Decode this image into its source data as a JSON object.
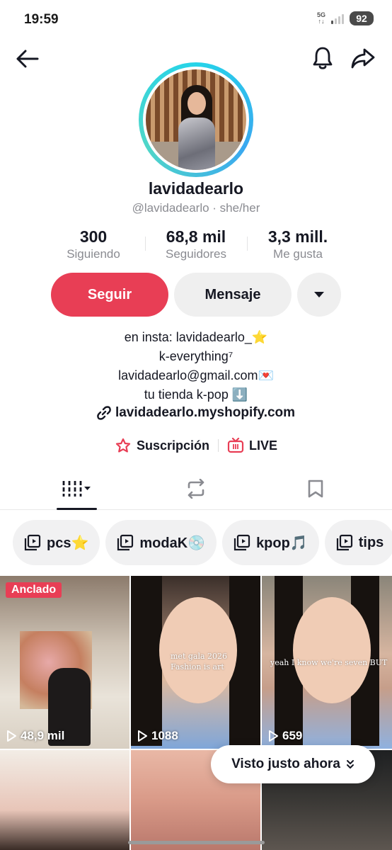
{
  "status_bar": {
    "time": "19:59",
    "network": "5G",
    "battery": "92"
  },
  "profile": {
    "username": "lavidadearlo",
    "handle_line": "@lavidadearlo · she/her"
  },
  "stats": [
    {
      "value": "300",
      "label": "Siguiendo"
    },
    {
      "value": "68,8 mil",
      "label": "Seguidores"
    },
    {
      "value": "3,3 mill.",
      "label": "Me gusta"
    }
  ],
  "actions": {
    "follow": "Seguir",
    "message": "Mensaje"
  },
  "bio": {
    "lines": [
      "en insta: lavidadearlo_⭐",
      "k-everything⁷",
      "lavidadearlo@gmail.com💌",
      "tu tienda k-pop ⬇️"
    ],
    "link": "lavidadearlo.myshopify.com"
  },
  "extras": {
    "subscription": "Suscripción",
    "live": "LIVE"
  },
  "playlists": [
    {
      "label": "pcs⭐"
    },
    {
      "label": "modaK💿"
    },
    {
      "label": "kpop🎵"
    },
    {
      "label": "tips"
    }
  ],
  "videos": [
    {
      "badge": "Anclado",
      "views": "48,9 mil"
    },
    {
      "views": "1088",
      "overlay": [
        "met gala 2026",
        "Fashion is art"
      ]
    },
    {
      "views": "659",
      "overlay": [
        "yeah I know we're seven BUT"
      ]
    }
  ],
  "toast": "Visto justo ahora",
  "colors": {
    "accent": "#e83e55",
    "avatar_ring": "#25d4e9",
    "text": "#161823",
    "muted": "#8a8b91"
  }
}
